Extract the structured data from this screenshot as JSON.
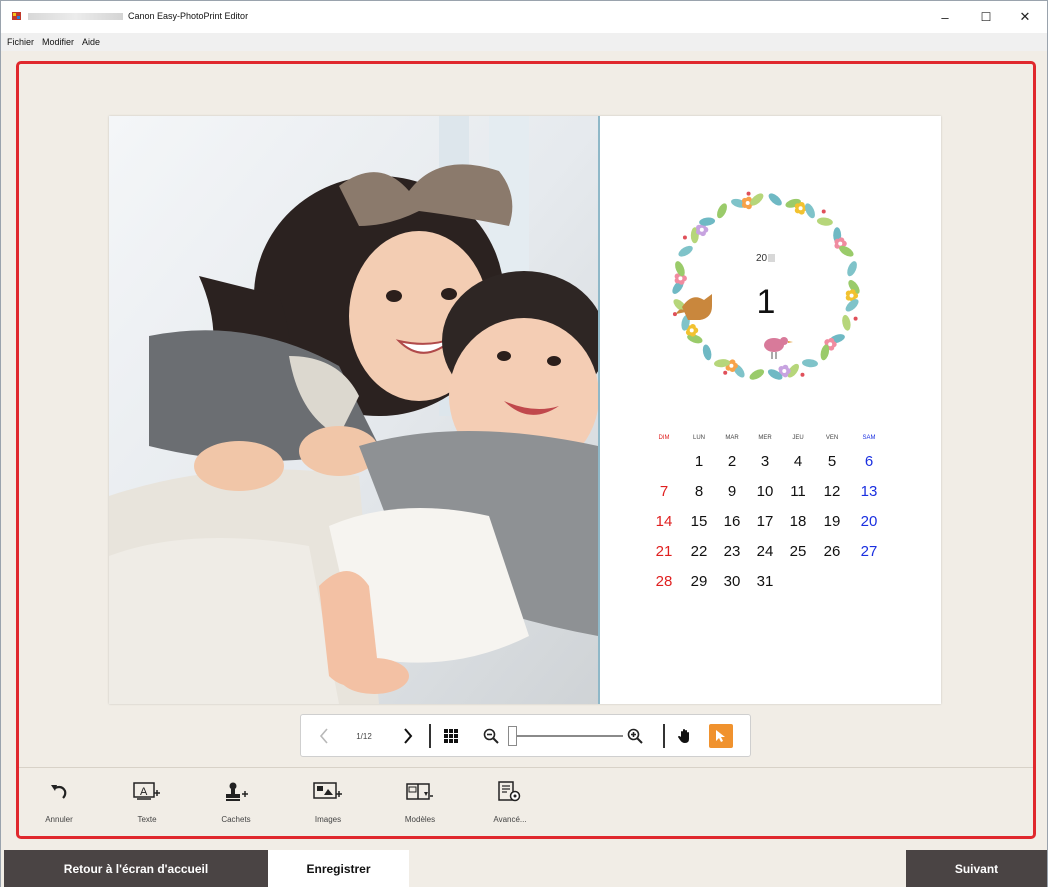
{
  "window": {
    "title": "Canon Easy-PhotoPrint Editor",
    "controls": {
      "minimize": "–",
      "maximize": "☐",
      "close": "✕"
    }
  },
  "menu": [
    "Fichier",
    "Modifier",
    "Aide"
  ],
  "calendar": {
    "year": "20",
    "month": "1",
    "weekdays": [
      "DIM",
      "LUN",
      "MAR",
      "MER",
      "JEU",
      "VEN",
      "SAM"
    ],
    "weeks": [
      [
        "",
        "1",
        "2",
        "3",
        "4",
        "5",
        "6"
      ],
      [
        "7",
        "8",
        "9",
        "10",
        "11",
        "12",
        "13"
      ],
      [
        "14",
        "15",
        "16",
        "17",
        "18",
        "19",
        "20"
      ],
      [
        "21",
        "22",
        "23",
        "24",
        "25",
        "26",
        "27"
      ],
      [
        "28",
        "29",
        "30",
        "31",
        "",
        "",
        ""
      ]
    ],
    "colors": {
      "sunday": "#e02020",
      "saturday": "#1a2fe0",
      "weekday": "#111111"
    }
  },
  "nav": {
    "page_indicator": "1/12",
    "zoom_level": 0
  },
  "tools": [
    {
      "label": "Annuler",
      "icon": "undo-icon"
    },
    {
      "label": "Texte",
      "icon": "text-icon"
    },
    {
      "label": "Cachets",
      "icon": "stamp-icon"
    },
    {
      "label": "Images",
      "icon": "images-icon"
    },
    {
      "label": "Modèles",
      "icon": "templates-icon"
    },
    {
      "label": "Avancé...",
      "icon": "advanced-icon"
    }
  ],
  "footer": {
    "home": "Retour à l'écran d'accueil",
    "save": "Enregistrer",
    "next": "Suivant"
  },
  "accent": {
    "selection_frame": "#e0282d",
    "pointer_active": "#f0922e",
    "footer_dark": "#4a4444"
  }
}
